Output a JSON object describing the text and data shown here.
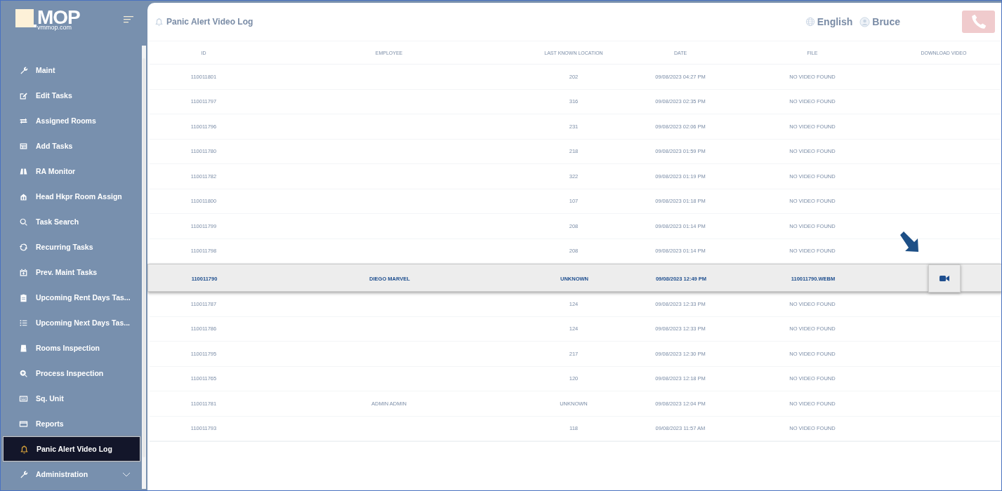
{
  "sidebar": {
    "logo": {
      "text": "MOP",
      "subtext": "vmmop.com"
    },
    "items": [
      {
        "label": "Maint",
        "selected": false,
        "has_submenu": false
      },
      {
        "label": "Edit Tasks",
        "selected": false,
        "has_submenu": false
      },
      {
        "label": "Assigned Rooms",
        "selected": false,
        "has_submenu": false
      },
      {
        "label": "Add Tasks",
        "selected": false,
        "has_submenu": false
      },
      {
        "label": "RA Monitor",
        "selected": false,
        "has_submenu": false
      },
      {
        "label": "Head Hkpr Room Assign",
        "selected": false,
        "has_submenu": false
      },
      {
        "label": "Task Search",
        "selected": false,
        "has_submenu": false
      },
      {
        "label": "Recurring Tasks",
        "selected": false,
        "has_submenu": false
      },
      {
        "label": "Prev. Maint Tasks",
        "selected": false,
        "has_submenu": false
      },
      {
        "label": "Upcoming Rent Days Tas...",
        "selected": false,
        "has_submenu": false
      },
      {
        "label": "Upcoming Next Days Tas...",
        "selected": false,
        "has_submenu": false
      },
      {
        "label": "Rooms Inspection",
        "selected": false,
        "has_submenu": false
      },
      {
        "label": "Process Inspection",
        "selected": false,
        "has_submenu": false
      },
      {
        "label": "Sq. Unit",
        "selected": false,
        "has_submenu": false
      },
      {
        "label": "Reports",
        "selected": false,
        "has_submenu": false
      },
      {
        "label": "Panic Alert Video Log",
        "selected": true,
        "has_submenu": false
      },
      {
        "label": "Administration",
        "selected": false,
        "has_submenu": true
      }
    ]
  },
  "header": {
    "title": "Panic Alert Video Log",
    "language": "English",
    "user": "Bruce"
  },
  "table": {
    "columns": [
      "ID",
      "EMPLOYEE",
      "LAST KNOWN LOCATION",
      "DATE",
      "FILE",
      "DOWNLOAD VIDEO"
    ],
    "rows": [
      {
        "id": "110011801",
        "location": "202",
        "date": "09/08/2023 04:27 PM",
        "file": "NO VIDEO FOUND",
        "selected": false,
        "video_button": false
      },
      {
        "id": "110011797",
        "location": "316",
        "date": "09/08/2023 02:35 PM",
        "file": "NO VIDEO FOUND",
        "selected": false,
        "video_button": false
      },
      {
        "id": "110011796",
        "location": "231",
        "date": "09/08/2023 02:06 PM",
        "file": "NO VIDEO FOUND",
        "selected": false,
        "video_button": false
      },
      {
        "id": "110011780",
        "location": "218",
        "date": "09/08/2023 01:59 PM",
        "file": "NO VIDEO FOUND",
        "selected": false,
        "video_button": false
      },
      {
        "id": "110011782",
        "location": "322",
        "date": "09/08/2023 01:19 PM",
        "file": "NO VIDEO FOUND",
        "selected": false,
        "video_button": false
      },
      {
        "id": "110011800",
        "location": "107",
        "date": "09/08/2023 01:18 PM",
        "file": "NO VIDEO FOUND",
        "selected": false,
        "video_button": false
      },
      {
        "id": "110011799",
        "location": "208",
        "date": "09/08/2023 01:14 PM",
        "file": "NO VIDEO FOUND",
        "selected": false,
        "video_button": false
      },
      {
        "id": "110011798",
        "location": "208",
        "date": "09/08/2023 01:14 PM",
        "file": "NO VIDEO FOUND",
        "selected": false,
        "video_button": false
      },
      {
        "id": "110011790",
        "employee": "DIEGO MARVEL",
        "location": "UNKNOWN",
        "date": "09/08/2023 12:49 PM",
        "file": "110011790.WEBM",
        "selected": true,
        "video_button": true
      },
      {
        "id": "110011787",
        "location": "124",
        "date": "09/08/2023 12:33 PM",
        "file": "NO VIDEO FOUND",
        "selected": false,
        "video_button": false
      },
      {
        "id": "110011786",
        "location": "124",
        "date": "09/08/2023 12:33 PM",
        "file": "NO VIDEO FOUND",
        "selected": false,
        "video_button": false
      },
      {
        "id": "110011795",
        "location": "217",
        "date": "09/08/2023 12:30 PM",
        "file": "NO VIDEO FOUND",
        "selected": false,
        "video_button": false
      },
      {
        "id": "110011765",
        "location": "120",
        "date": "09/08/2023 12:18 PM",
        "file": "NO VIDEO FOUND",
        "selected": false,
        "video_button": false
      },
      {
        "id": "110011781",
        "employee": "ADMIN ADMIN",
        "location": "UNKNOWN",
        "date": "09/08/2023 12:04 PM",
        "file": "NO VIDEO FOUND",
        "selected": false,
        "video_button": false
      },
      {
        "id": "110011793",
        "location": "118",
        "date": "09/08/2023 11:57 AM",
        "file": "NO VIDEO FOUND",
        "selected": false,
        "video_button": false
      }
    ]
  }
}
